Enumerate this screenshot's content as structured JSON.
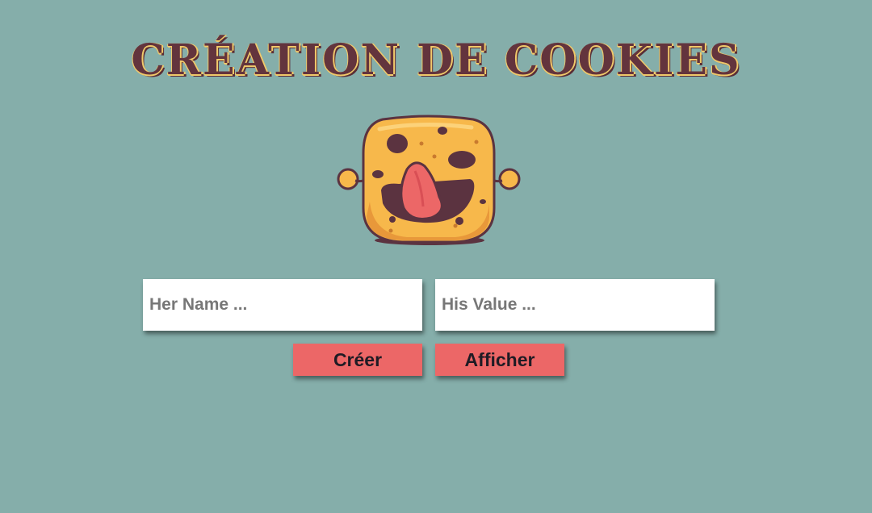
{
  "page": {
    "title": "CRÉATION DE COOKIES",
    "background": "#85aeaa"
  },
  "mascot": {
    "icon": "cookie-mascot-icon"
  },
  "form": {
    "name_placeholder": "Her Name ...",
    "name_value": "",
    "value_placeholder": "His Value ...",
    "value_value": ""
  },
  "actions": {
    "create_label": "Créer",
    "show_label": "Afficher",
    "button_color": "#ec6767"
  },
  "colors": {
    "title": "#63343d",
    "title_accent": "#f0c96a",
    "cookie": "#f7b84b",
    "cookie_dark": "#5b3340",
    "tongue": "#ec6767"
  }
}
